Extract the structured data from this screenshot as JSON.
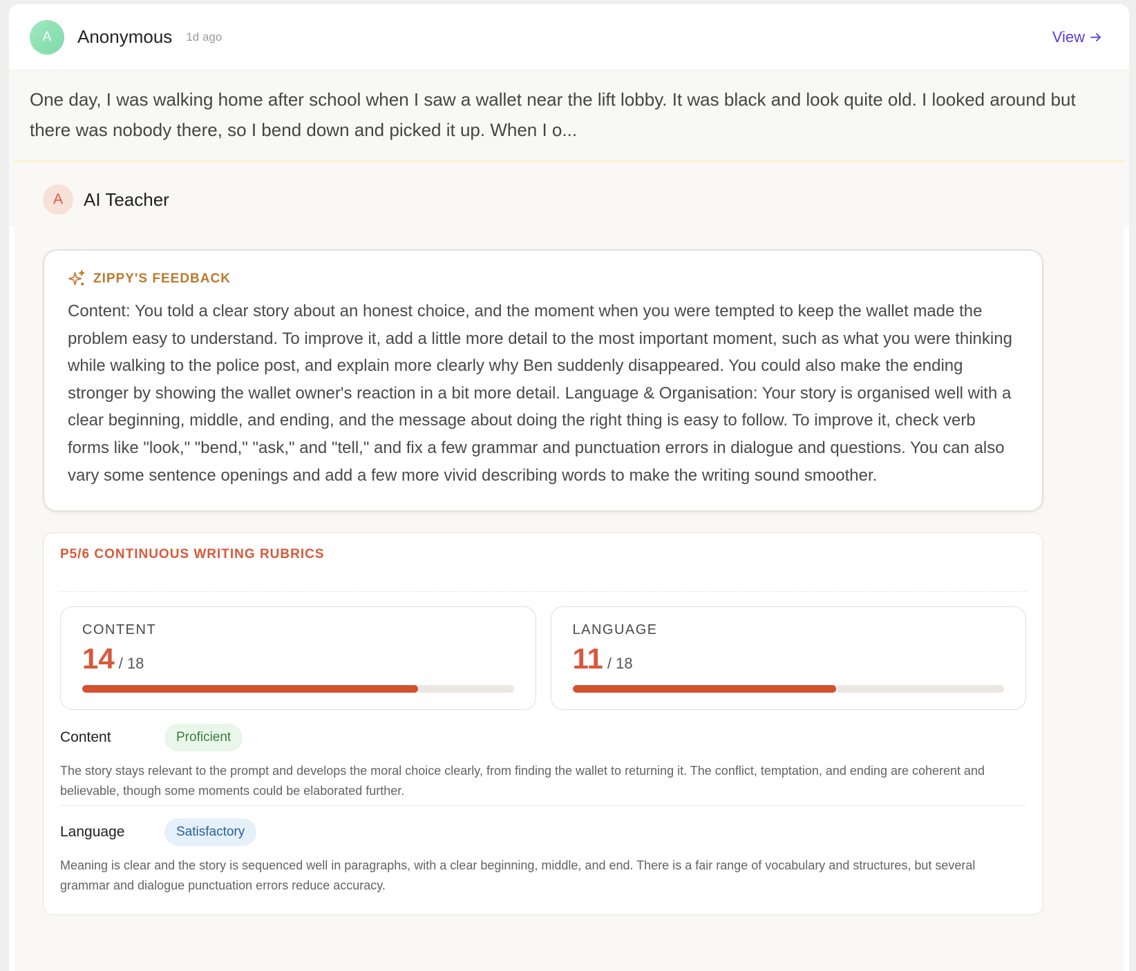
{
  "post": {
    "avatar_initial": "A",
    "author": "Anonymous",
    "time": "1d ago",
    "view_label": "View",
    "excerpt": "One day, I was walking home after school when I saw a wallet near the lift lobby. It was black and look quite old. I looked around but there was nobody there, so I bend down and picked it up. When I o..."
  },
  "teacher": {
    "avatar_initial": "A",
    "name": "AI Teacher"
  },
  "feedback": {
    "title": "ZIPPY'S FEEDBACK",
    "body": "Content: You told a clear story about an honest choice, and the moment when you were tempted to keep the wallet made the problem easy to understand. To improve it, add a little more detail to the most important moment, such as what you were thinking while walking to the police post, and explain more clearly why Ben suddenly disappeared. You could also make the ending stronger by showing the wallet owner's reaction in a bit more detail. Language & Organisation: Your story is organised well with a clear beginning, middle, and ending, and the message about doing the right thing is easy to follow. To improve it, check verb forms like \"look,\" \"bend,\" \"ask,\" and \"tell,\" and fix a few grammar and punctuation errors in dialogue and questions. You can also vary some sentence openings and add a few more vivid describing words to make the writing sound smoother."
  },
  "rubric": {
    "title": "P5/6 CONTINUOUS WRITING RUBRICS",
    "scores": [
      {
        "label": "CONTENT",
        "value": "14",
        "max_text": "/ 18",
        "fraction": 0.7778
      },
      {
        "label": "LANGUAGE",
        "value": "11",
        "max_text": "/ 18",
        "fraction": 0.6111
      }
    ],
    "criteria": [
      {
        "name": "Content",
        "level": "Proficient",
        "description": "The story stays relevant to the prompt and develops the moral choice clearly, from finding the wallet to returning it. The conflict, temptation, and ending are coherent and believable, though some moments could be elaborated further."
      },
      {
        "name": "Language",
        "level": "Satisfactory",
        "description": "Meaning is clear and the story is sequenced well in paragraphs, with a clear beginning, middle, and end. There is a fair range of vocabulary and structures, but several grammar and dialogue punctuation errors reduce accuracy."
      }
    ]
  },
  "colors": {
    "accent_orange": "#d9583a",
    "feedback_gold": "#bd7a2c",
    "link_purple": "#5b3be0"
  },
  "icons": {
    "view_arrow": "arrow-right-icon",
    "feedback": "sparkle-icon"
  }
}
